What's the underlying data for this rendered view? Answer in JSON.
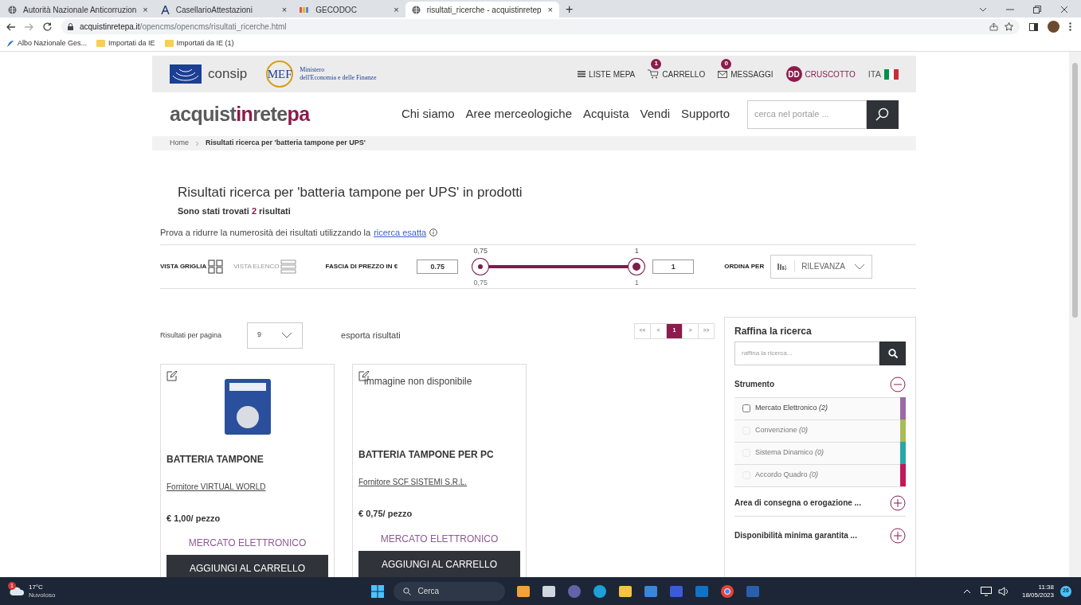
{
  "browser": {
    "tabs": [
      {
        "title": "Autorità Nazionale Anticorruzion",
        "close": "×",
        "selected": false
      },
      {
        "title": "CasellarioAttestazioni",
        "close": "×",
        "selected": false
      },
      {
        "title": "GECODOC",
        "close": "×",
        "selected": false
      },
      {
        "title": "risultati_ricerche - acquistinretep",
        "close": "×",
        "selected": true
      }
    ],
    "new_tab": "+",
    "url_host": "acquistinretepa.it",
    "url_path": "/opencms/opencms/risultati_ricerche.html",
    "bookmarks": [
      {
        "label": "Albo Nazionale Ges...",
        "kind": "site"
      },
      {
        "label": "Importati da IE",
        "kind": "folder"
      },
      {
        "label": "Importati da IE (1)",
        "kind": "folder"
      }
    ]
  },
  "top_bar": {
    "consip": "consip",
    "mef": "MEF",
    "ministry_line1": "Ministero",
    "ministry_line2": "dell'Economia e delle Finanze",
    "links": [
      {
        "label": "LISTE MEPA",
        "kind": "menu"
      },
      {
        "label": "CARRELLO",
        "kind": "cart",
        "badge": "1"
      },
      {
        "label": "MESSAGGI",
        "kind": "mail",
        "badge": "0"
      },
      {
        "label": "CRUSCOTTO",
        "kind": "user",
        "initials": "DD"
      },
      {
        "label": "ITA",
        "kind": "lang"
      }
    ]
  },
  "nav": {
    "logo": [
      {
        "text": "acquist",
        "accent": false
      },
      {
        "text": "in",
        "accent": true
      },
      {
        "text": "rete",
        "accent": false
      },
      {
        "text": "pa",
        "accent": true
      }
    ],
    "links": [
      "Chi siamo",
      "Aree merceologiche",
      "Acquista",
      "Vendi",
      "Supporto"
    ],
    "search_placeholder": "cerca nel portale ..."
  },
  "breadcrumb": [
    "Home",
    "Risultati ricerca per 'batteria tampone per UPS'"
  ],
  "results": {
    "title": "Risultati ricerca per 'batteria tampone per UPS' in prodotti",
    "count_before": "Sono stati trovati",
    "count": "2",
    "count_after": "risultati",
    "hint": "Prova a ridurre la numerosità dei risultati utilizzando la",
    "hint_link": "ricerca esatta"
  },
  "toolbar": {
    "views": [
      {
        "label": "VISTA GRIGLIA",
        "kind": "grid",
        "selected": true
      },
      {
        "label": "VISTA ELENCO",
        "kind": "list",
        "selected": false
      }
    ],
    "price_label": "FASCIA DI PREZZO IN €",
    "price_min": "0.75",
    "price_max": "1",
    "thumbs": [
      {
        "level": 0,
        "top_label": "0,75",
        "bottom_label": "0,75"
      },
      {
        "level": 1,
        "top_label": "1",
        "bottom_label": "1"
      }
    ],
    "sort_label": "ORDINA PER",
    "sort_value": "RILEVANZA"
  },
  "paging": {
    "per_page_label": "Risultati per pagina",
    "per_page": "9",
    "export": "esporta risultati",
    "pages": [
      {
        "label": "<<",
        "selected": false
      },
      {
        "label": "<",
        "selected": false
      },
      {
        "label": "1",
        "selected": true
      },
      {
        "label": ">",
        "selected": false
      },
      {
        "label": ">>",
        "selected": false
      }
    ]
  },
  "products": [
    {
      "name": "BATTERIA TAMPONE",
      "supplier": "Fornitore VIRTUAL WORLD",
      "price": "€ 1,00/ pezzo",
      "market": "MERCATO ELETTRONICO",
      "button": "AGGIUNGI AL CARRELLO"
    },
    {
      "image_alt": "immagine non disponibile",
      "name": "BATTERIA TAMPONE PER PC",
      "supplier": "Fornitore SCF SISTEMI S.R.L.",
      "price": "€ 0,75/ pezzo",
      "market": "MERCATO ELETTRONICO",
      "button": "AGGIUNGI AL CARRELLO"
    }
  ],
  "refine": {
    "title": "Raffina la ricerca",
    "placeholder": "raffina la ricerca...",
    "sections": [
      {
        "label": "Strumento",
        "expanded": true,
        "options": [
          {
            "label": "Mercato Elettronico",
            "count": "(2)",
            "checked": false,
            "disabled": false,
            "color": "#9b6aa6"
          },
          {
            "label": "Convenzione",
            "count": "(0)",
            "checked": false,
            "disabled": true,
            "color": "#a8bd56"
          },
          {
            "label": "Sistema Dinamico",
            "count": "(0)",
            "checked": false,
            "disabled": true,
            "color": "#2aa6a6"
          },
          {
            "label": "Accordo Quadro",
            "count": "(0)",
            "checked": false,
            "disabled": true,
            "color": "#c2185b"
          }
        ]
      },
      {
        "label": "Area di consegna o erogazione ...",
        "expanded": false
      },
      {
        "label": "Disponibilità minima garantita ...",
        "expanded": false
      }
    ]
  },
  "taskbar": {
    "temp": "17°C",
    "weather": "Nuvoloso",
    "weather_badge": "1",
    "search": "Cerca",
    "time": "11:38",
    "date": "18/05/2023",
    "notif": "26"
  }
}
